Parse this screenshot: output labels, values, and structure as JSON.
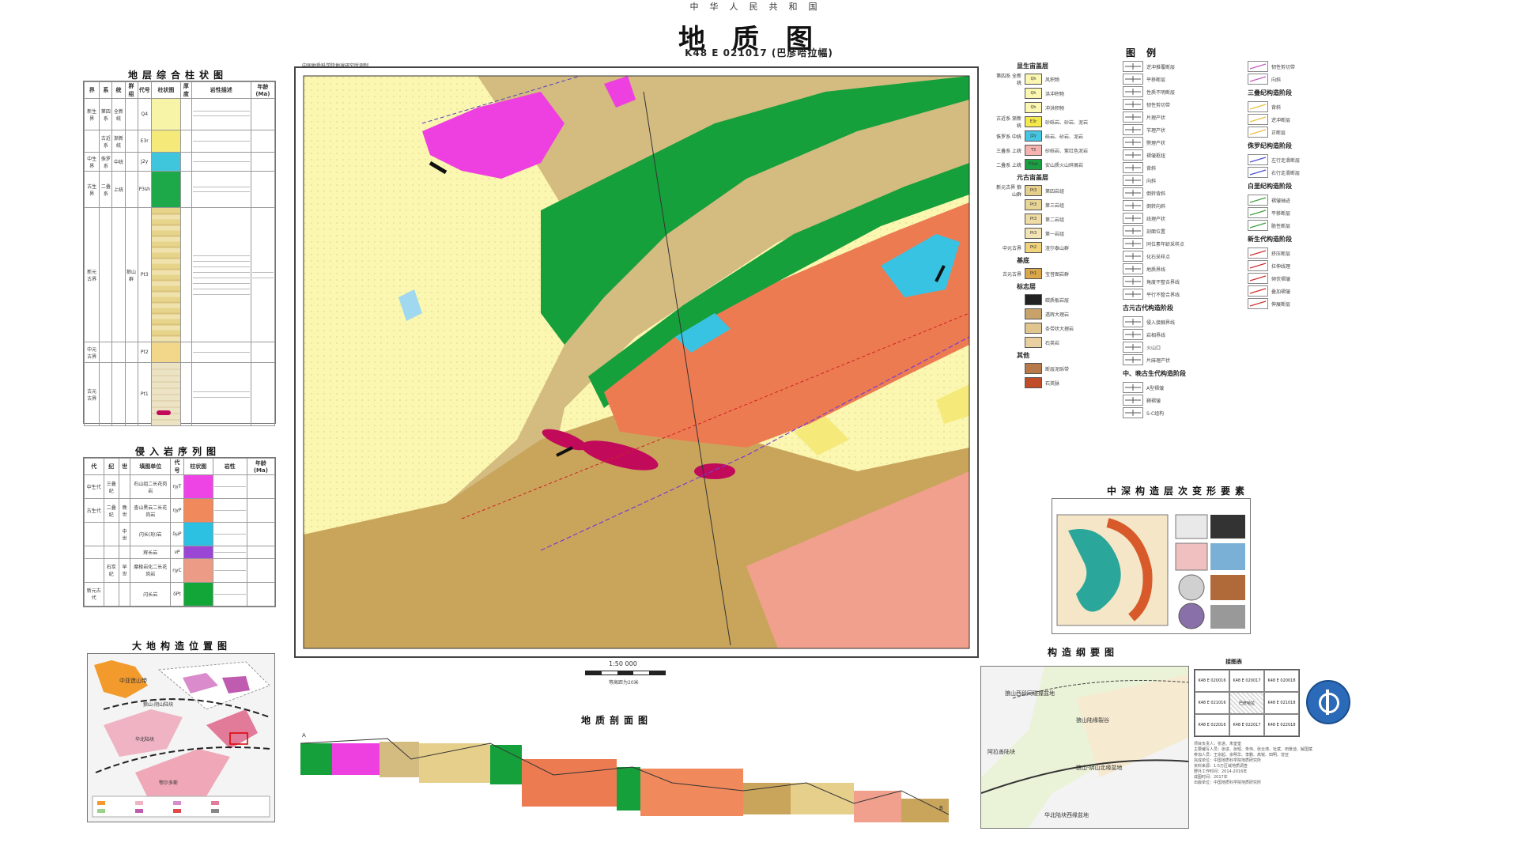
{
  "header": {
    "country": "中华人民共和国",
    "title": "地质图",
    "sheet_no": "K48 E 021017 (巴彦哈拉幅)",
    "institute": "中国地质科学院地球研究所测制"
  },
  "strat_column": {
    "title": "地层综合柱状图",
    "headers": [
      "界",
      "系",
      "统",
      "群组",
      "代号",
      "柱状图",
      "厚度",
      "岩性描述",
      "年龄 (Ma)"
    ],
    "rows": [
      {
        "era": "新生界",
        "system": "第四系",
        "series": "全新统",
        "code": "Q4",
        "color": "#f7f4a8"
      },
      {
        "era": "",
        "system": "古近系",
        "series": "渐新统",
        "code": "E3r",
        "color": "#f5e97a"
      },
      {
        "era": "中生界",
        "system": "侏罗系",
        "series": "中统",
        "code": "J2y",
        "color": "#3fc6dd"
      },
      {
        "era": "古生界",
        "system": "二叠系",
        "series": "上统",
        "code": "P3sh",
        "color": "#1da84a"
      },
      {
        "era": "新元古界",
        "system": "",
        "series": "",
        "code": "Pt3",
        "color": "#e6d48a"
      },
      {
        "era": "中元古界",
        "system": "",
        "series": "",
        "code": "Pt2",
        "color": "#f2d68a"
      },
      {
        "era": "古元古界",
        "system": "",
        "series": "",
        "code": "Pt1",
        "color": "#ece3c5"
      }
    ]
  },
  "intrusive": {
    "title": "侵入岩序列图",
    "headers": [
      "代",
      "纪",
      "世",
      "填图单位",
      "代号",
      "柱状图",
      "岩性",
      "年龄 (Ma)"
    ],
    "rows": [
      {
        "era": "中生代",
        "period": "三叠纪",
        "epoch": "",
        "unit": "石山组二长花岗岩",
        "code": "ηγT",
        "color": "#ee44e6"
      },
      {
        "era": "古生代",
        "period": "二叠纪",
        "epoch": "晚世",
        "unit": "查山黑云二长花岗岩",
        "code": "ηγP",
        "color": "#f08a5d"
      },
      {
        "era": "",
        "period": "",
        "epoch": "中世",
        "unit": "闪长(玢)岩",
        "code": "δμP",
        "color": "#2cc0e2"
      },
      {
        "era": "",
        "period": "",
        "epoch": "",
        "unit": "辉长岩",
        "code": "νP",
        "color": "#9b45d4"
      },
      {
        "era": "",
        "period": "石炭纪",
        "epoch": "早世",
        "unit": "糜棱岩化二长花岗岩",
        "code": "ηγC",
        "color": "#ec9c86"
      },
      {
        "era": "新元古代",
        "period": "",
        "epoch": "",
        "unit": "闪长岩",
        "code": "δPt",
        "color": "#12a638"
      }
    ]
  },
  "tectonic_position": {
    "title": "大地构造位置图",
    "labels": [
      "中亚造山带",
      "狼山-阴山陆块",
      "华北陆块",
      "鄂尔多斯"
    ]
  },
  "main_map": {
    "scale": "1:50 000",
    "contour_note": "等高距为20米"
  },
  "section": {
    "title": "地质剖面图",
    "label_a": "A",
    "label_b": "B"
  },
  "legend": {
    "title": "图例",
    "col1_groups": [
      {
        "heading": "显生宙盖层",
        "items": [
          {
            "group": "第四系 全新统",
            "code": "Qh",
            "label": "风积物",
            "color": "#fbf6b0"
          },
          {
            "group": "",
            "code": "Qh",
            "label": "洪冲积物",
            "color": "#fbf6b0"
          },
          {
            "group": "",
            "code": "Qh",
            "label": "冲洪积物",
            "color": "#fbf6b0"
          },
          {
            "group": "古近系 渐新统",
            "code": "E3r",
            "label": "砂砾岩、砂岩、泥岩",
            "color": "#f4e84a"
          },
          {
            "group": "侏罗系 中统",
            "code": "J2y",
            "label": "砾岩、砂岩、泥岩",
            "color": "#45c7e4"
          },
          {
            "group": "三叠系 上统",
            "code": "T3",
            "label": "砂砾岩、紫红色泥岩",
            "color": "#f5b3b0"
          },
          {
            "group": "二叠系 上统",
            "code": "P3sh",
            "label": "安山质火山碎屑岩",
            "color": "#1aa043"
          }
        ]
      },
      {
        "heading": "元古宙盖层",
        "items": [
          {
            "group": "新元古界 狼山群",
            "code": "Pt3",
            "label": "第四岩组",
            "color": "#e5cf8a"
          },
          {
            "group": "",
            "code": "Pt3",
            "label": "第三岩组",
            "color": "#e8d596"
          },
          {
            "group": "",
            "code": "Pt3",
            "label": "第二岩组",
            "color": "#eedca4"
          },
          {
            "group": "",
            "code": "Pt3",
            "label": "第一岩组",
            "color": "#f2e3b4"
          },
          {
            "group": "中元古界",
            "code": "Pt2",
            "label": "渣尔泰山群",
            "color": "#f1d37c"
          }
        ]
      },
      {
        "heading": "基底",
        "items": [
          {
            "group": "古元古界",
            "code": "Pt1",
            "label": "宝音图岩群",
            "color": "#d9a64a"
          }
        ]
      },
      {
        "heading": "标志层",
        "items": [
          {
            "group": "",
            "code": "",
            "label": "碳质板岩层",
            "color": "#222222"
          },
          {
            "group": "",
            "code": "",
            "label": "透辉大理岩",
            "color": "#c9a26a"
          },
          {
            "group": "",
            "code": "",
            "label": "条带状大理岩",
            "color": "#e1c58f"
          },
          {
            "group": "",
            "code": "",
            "label": "石英岩",
            "color": "#e8d0a0"
          }
        ]
      },
      {
        "heading": "其他",
        "items": [
          {
            "group": "",
            "code": "",
            "label": "断层泥砾带",
            "color": "#b7794a"
          },
          {
            "group": "",
            "code": "",
            "label": "石英脉",
            "color": "#c04c2a"
          }
        ]
      }
    ],
    "col2_items": [
      "逆冲推覆断层",
      "平移断层",
      "性质不明断层",
      "韧性剪切带",
      "片理产状",
      "节理产状",
      "劈理产状",
      "褶皱枢纽",
      "背斜",
      "向斜",
      "倒转背斜",
      "倒转向斜",
      "线理产状",
      "剖面位置",
      "同位素年龄采样点",
      "化石采样点",
      "地质界线",
      "角度不整合界线",
      "平行不整合界线",
      "侵入接触界线",
      "岩相界线",
      "火山口",
      "片麻理产状",
      "A型褶皱",
      "鞘褶皱",
      "S-C组构"
    ],
    "col2_headings": [
      "古元古代构造阶段",
      "中、晚古生代构造阶段"
    ],
    "col3_headings": [
      "三叠纪构造阶段",
      "侏罗纪构造阶段",
      "白垩纪构造阶段",
      "新生代构造阶段"
    ],
    "col3_items": [
      "韧性剪切带",
      "向斜",
      "背斜",
      "逆冲断层",
      "正断层",
      "左行走滑断层",
      "右行走滑断层",
      "褶皱轴迹",
      "平移断层",
      "脆性断层",
      "挤压断层",
      "拉伸线理",
      "倾伏褶皱",
      "叠加褶皱",
      "伸展断层"
    ]
  },
  "deformation": {
    "title": "中深构造层次变形要素"
  },
  "structure_outline": {
    "title": "构造纲要图",
    "labels": [
      "狼山西段同碰撞盆地",
      "狼山陆缘裂谷",
      "狼山-阴山北缘盆地",
      "华北陆块西缘盆地",
      "阿拉善陆块"
    ]
  },
  "index_table": {
    "title": "接图表",
    "cells": [
      "K48 E 020016",
      "K48 E 020017",
      "K48 E 020018",
      "K48 E 021016",
      "巴彦哈拉",
      "K48 E 021018",
      "K48 E 022016",
      "K48 E 022017",
      "K48 E 022018"
    ]
  },
  "credits": {
    "lines": [
      "项目负责人：张进、朱奎奎",
      "主要编写人员：张进、张昭、朱伟、张云涛、杜斌、田景迪、解国斌",
      "参加人员：王宗起、余明华、李鹏、高锐、田明、曾亚",
      "完成单位：中国地质科学院地质研究所",
      "资料来源：1:5万区域地质调查",
      "野外工作时间：2014-2016年",
      "成图时间：2017年",
      "出版单位：中国地质科学院地质研究所"
    ]
  },
  "colors": {
    "quaternary": "#fbf6b0",
    "eogene": "#f5e97a",
    "jurassic": "#39c3e2",
    "permian": "#16a03c",
    "granite_P": "#ec7b52",
    "granite_T": "#ee3fe0",
    "pt_brown": "#c9a55c",
    "pt_tan": "#d4bb80",
    "pink": "#f0a08c",
    "crimson": "#c20a5a"
  }
}
